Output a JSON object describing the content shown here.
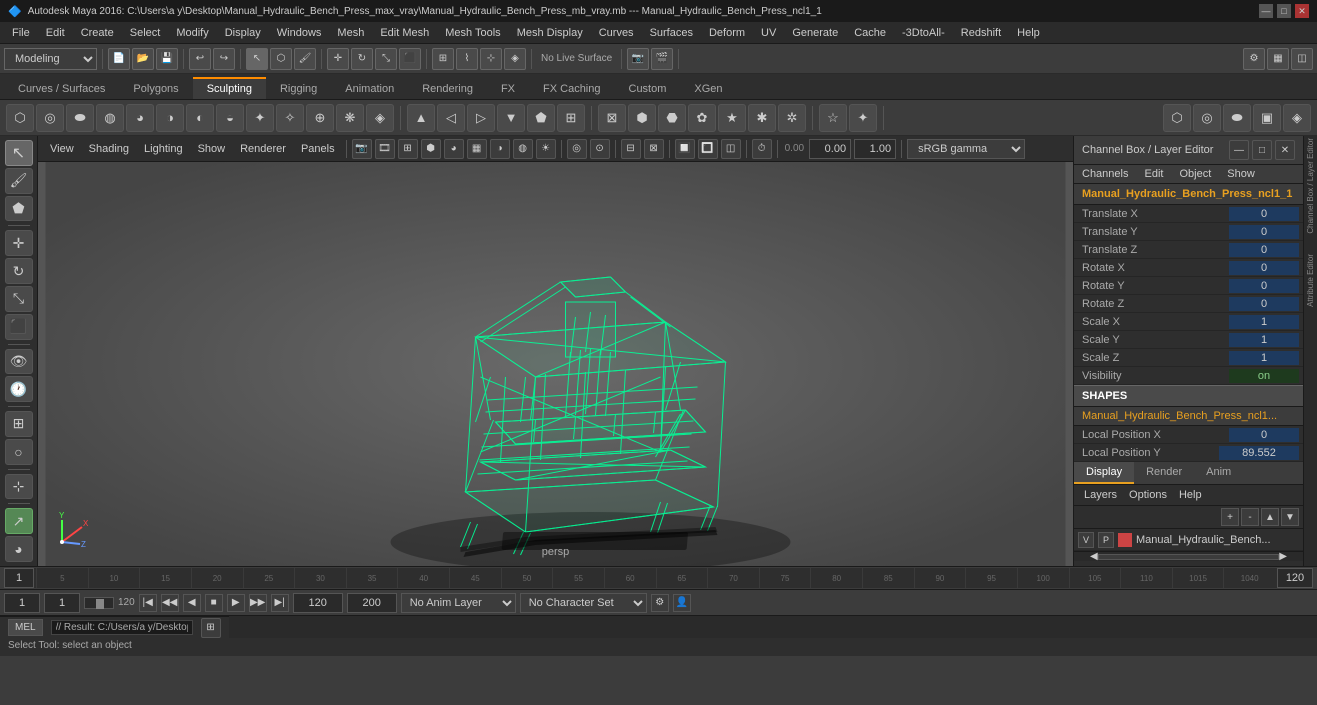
{
  "title_bar": {
    "logo": "🔷",
    "title": "Autodesk Maya 2016: C:\\Users\\a y\\Desktop\\Manual_Hydraulic_Bench_Press_max_vray\\Manual_Hydraulic_Bench_Press_mb_vray.mb  ---  Manual_Hydraulic_Bench_Press_ncl1_1",
    "min_btn": "—",
    "max_btn": "□",
    "close_btn": "✕"
  },
  "menu_bar": {
    "items": [
      "File",
      "Edit",
      "Create",
      "Select",
      "Modify",
      "Display",
      "Windows",
      "Mesh",
      "Edit Mesh",
      "Mesh Tools",
      "Mesh Display",
      "Curves",
      "Surfaces",
      "Deform",
      "UV",
      "Generate",
      "Cache",
      "-3DtoAll-",
      "Redshift",
      "Help"
    ]
  },
  "toolbar1": {
    "workspace_label": "Modeling",
    "workspace_dropdown_arrow": "▼"
  },
  "tabs": {
    "items": [
      "Curves / Surfaces",
      "Polygons",
      "Sculpting",
      "Rigging",
      "Animation",
      "Rendering",
      "FX",
      "FX Caching",
      "Custom",
      "XGen"
    ],
    "active": "Sculpting"
  },
  "sculpt_tools": {
    "tools": [
      "⬡",
      "◎",
      "⬬",
      "◍",
      "◕",
      "◑",
      "◐",
      "◒",
      "✦",
      "✧",
      "⊕",
      "❋",
      "◈",
      "▲",
      "◁",
      "▷",
      "▼",
      "⬟",
      "⊞",
      "⊠",
      "⬢",
      "⬣",
      "✿",
      "★",
      "✱",
      "✲",
      "☆",
      "✦",
      "✧",
      "⊗",
      "⊘"
    ],
    "right_tools": [
      "⬡",
      "◎",
      "⬬",
      "▣",
      "◈"
    ]
  },
  "viewport": {
    "menus": [
      "View",
      "Shading",
      "Lighting",
      "Show",
      "Renderer",
      "Panels"
    ],
    "gamma_label": "sRGB gamma",
    "num1_label": "0.00",
    "num2_label": "1.00",
    "persp_label": "persp",
    "axis_x_color": "#ff4444",
    "axis_y_color": "#44ff44",
    "axis_z_color": "#4444ff"
  },
  "channel_box": {
    "header_label": "Channel Box / Layer Editor",
    "menus": [
      "Channels",
      "Edit",
      "Object",
      "Show"
    ],
    "object_name": "Manual_Hydraulic_Bench_Press_ncl1_1",
    "translate_label": "Translate",
    "channels": [
      {
        "name": "Translate X",
        "value": "0"
      },
      {
        "name": "Translate Y",
        "value": "0"
      },
      {
        "name": "Translate Z",
        "value": "0"
      },
      {
        "name": "Rotate X",
        "value": "0"
      },
      {
        "name": "Rotate Y",
        "value": "0"
      },
      {
        "name": "Rotate Z",
        "value": "0"
      },
      {
        "name": "Scale X",
        "value": "1"
      },
      {
        "name": "Scale Y",
        "value": "1"
      },
      {
        "name": "Scale Z",
        "value": "1"
      },
      {
        "name": "Visibility",
        "value": "on"
      }
    ],
    "shapes_label": "SHAPES",
    "shapes_object": "Manual_Hydraulic_Bench_Press_ncl1...",
    "shape_channels": [
      {
        "name": "Local Position X",
        "value": "0"
      },
      {
        "name": "Local Position Y",
        "value": "89.552"
      }
    ]
  },
  "display_tabs": {
    "items": [
      "Display",
      "Render",
      "Anim"
    ],
    "active": "Display"
  },
  "layer_panel": {
    "menus": [
      "Layers",
      "Options",
      "Help"
    ],
    "row": {
      "v": "V",
      "p": "P",
      "name": "Manual_Hydraulic_Bench..."
    }
  },
  "timeline": {
    "ticks": [
      "5",
      "10",
      "15",
      "20",
      "25",
      "30",
      "35",
      "40",
      "45",
      "50",
      "55",
      "60",
      "65",
      "70",
      "75",
      "80",
      "85",
      "90",
      "95",
      "100",
      "105",
      "110",
      "1015",
      "1040"
    ],
    "start": "1",
    "end1": "120",
    "end2": "200",
    "anim_layer": "No Anim Layer",
    "char_set": "No Character Set",
    "current_frame_left": "1",
    "current_frame_right": "1"
  },
  "status_bar": {
    "mel_label": "MEL",
    "status_text": "// Result: C:/Users/a y/Desktop/Manual_Hydraulic_Bench_Press_max_vray/Manual_Hydraulic_Bench_Press_mb_vray.mb",
    "hint_text": "Select Tool: select an object"
  },
  "right_sidebar_labels": {
    "top": "Channel Box / Layer Editor",
    "bottom": "Attribute Editor"
  }
}
